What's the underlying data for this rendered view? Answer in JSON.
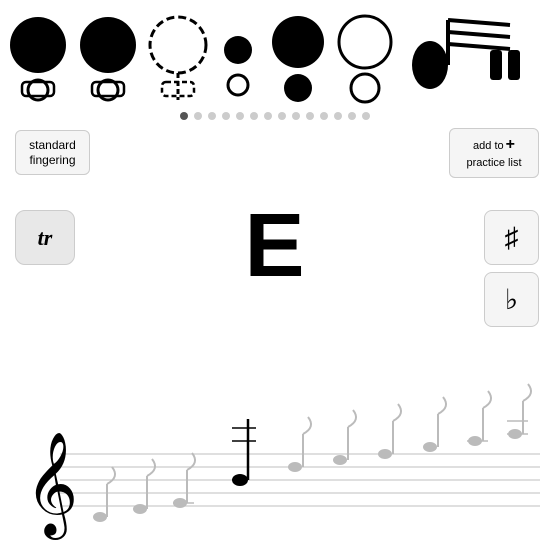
{
  "fingering": {
    "title": "Fingering Diagram"
  },
  "dots": {
    "total": 14,
    "active_index": 0
  },
  "buttons": {
    "standard_fingering": "standard\nfingering",
    "standard_fingering_line1": "standard",
    "standard_fingering_line2": "fingering",
    "practice_list_line1": "add to",
    "practice_list_line2": "practice list",
    "practice_list_plus": "+",
    "trill": "tr",
    "sharp": "♯",
    "flat": "♭"
  },
  "note": {
    "letter": "E"
  },
  "staff": {
    "clef": "treble"
  }
}
